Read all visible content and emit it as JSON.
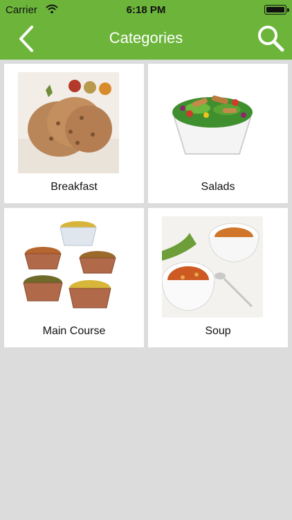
{
  "status_bar": {
    "carrier": "Carrier",
    "time": "6:18 PM"
  },
  "nav": {
    "title": "Categories"
  },
  "categories": [
    {
      "label": "Breakfast"
    },
    {
      "label": "Salads"
    },
    {
      "label": "Main Course"
    },
    {
      "label": "Soup"
    }
  ],
  "colors": {
    "header": "#6cb53a",
    "background": "#dcdcdc",
    "card": "#ffffff"
  },
  "icons": {
    "back": "chevron-left-icon",
    "search": "magnifier-icon",
    "wifi": "wifi-icon",
    "battery": "battery-icon"
  }
}
